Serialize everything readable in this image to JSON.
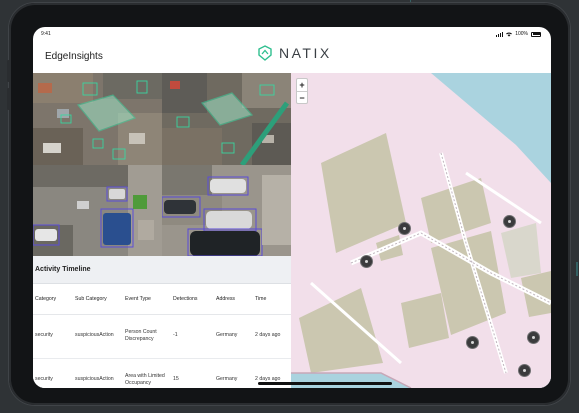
{
  "status_bar": {
    "time": "9:41",
    "battery": "100%"
  },
  "app": {
    "title": "EdgeInsights",
    "brand": "NATIX"
  },
  "map_controls": {
    "zoom_in": "+",
    "zoom_out": "−"
  },
  "timeline": {
    "title": "Activity Timeline",
    "columns": [
      "Category",
      "Sub Category",
      "Event Type",
      "Detections",
      "Address",
      "Time"
    ],
    "rows": [
      [
        "security",
        "suspiciousAction",
        "Person Count Discrepancy",
        "-1",
        "Germany",
        "2 days ago"
      ],
      [
        "security",
        "suspiciousAction",
        "Area with Limited Occupancy",
        "15",
        "Germany",
        "2 days ago"
      ]
    ]
  },
  "colors": {
    "frame": "#121416",
    "map_water": "#aad3df",
    "map_land": "#f2dfea",
    "map_building": "#cbc7b0",
    "detection_box_primary": "#5a4cd8",
    "detection_box_secondary": "#3ad6a0"
  },
  "icons": {
    "brand_logo": "natix-shield-logo-icon",
    "wifi": "wifi-icon",
    "signal": "signal-icon",
    "battery": "battery-icon",
    "marker": "map-marker-icon"
  }
}
